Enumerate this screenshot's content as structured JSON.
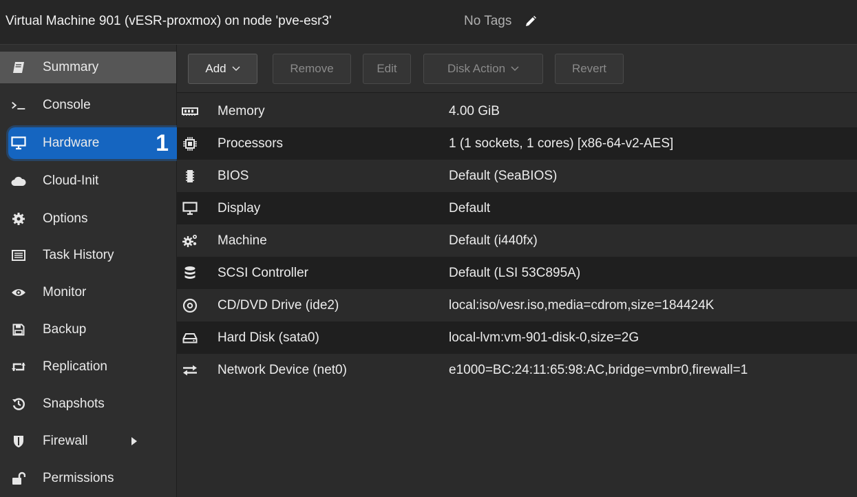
{
  "header": {
    "title": "Virtual Machine 901 (vESR-proxmox) on node 'pve-esr3'",
    "tags_label": "No Tags",
    "tag_edit_icon": "pencil-icon"
  },
  "sidebar": {
    "items": [
      {
        "label": "Summary",
        "icon": "book-icon"
      },
      {
        "label": "Console",
        "icon": "terminal-icon"
      },
      {
        "label": "Hardware",
        "icon": "desktop-icon",
        "badge": "1"
      },
      {
        "label": "Cloud-Init",
        "icon": "cloud-icon"
      },
      {
        "label": "Options",
        "icon": "gear-icon"
      },
      {
        "label": "Task History",
        "icon": "list-icon"
      },
      {
        "label": "Monitor",
        "icon": "eye-icon"
      },
      {
        "label": "Backup",
        "icon": "floppy-icon"
      },
      {
        "label": "Replication",
        "icon": "retweet-icon"
      },
      {
        "label": "Snapshots",
        "icon": "history-icon"
      },
      {
        "label": "Firewall",
        "icon": "shield-icon"
      },
      {
        "label": "Permissions",
        "icon": "unlock-icon"
      }
    ]
  },
  "toolbar": {
    "add": "Add",
    "remove": "Remove",
    "edit": "Edit",
    "disk_action": "Disk Action",
    "revert": "Revert"
  },
  "hardware": {
    "rows": [
      {
        "name": "Memory",
        "value": "4.00 GiB",
        "icon": "memory-icon"
      },
      {
        "name": "Processors",
        "value": "1 (1 sockets, 1 cores) [x86-64-v2-AES]",
        "icon": "cpu-icon"
      },
      {
        "name": "BIOS",
        "value": "Default (SeaBIOS)",
        "icon": "microchip-icon"
      },
      {
        "name": "Display",
        "value": "Default",
        "icon": "desktop-icon"
      },
      {
        "name": "Machine",
        "value": "Default (i440fx)",
        "icon": "cogs-icon"
      },
      {
        "name": "SCSI Controller",
        "value": "Default (LSI 53C895A)",
        "icon": "database-icon"
      },
      {
        "name": "CD/DVD Drive (ide2)",
        "value": "local:iso/vesr.iso,media=cdrom,size=184424K",
        "icon": "cdrom-icon"
      },
      {
        "name": "Hard Disk (sata0)",
        "value": "local-lvm:vm-901-disk-0,size=2G",
        "icon": "hdd-icon"
      },
      {
        "name": "Network Device (net0)",
        "value": "e1000=BC:24:11:65:98:AC,bridge=vmbr0,firewall=1",
        "icon": "exchange-icon"
      }
    ]
  },
  "colors": {
    "selected": "#1565c0",
    "active": "#565656",
    "background": "#2b2b2b",
    "alt_row": "#1f1f1f"
  }
}
